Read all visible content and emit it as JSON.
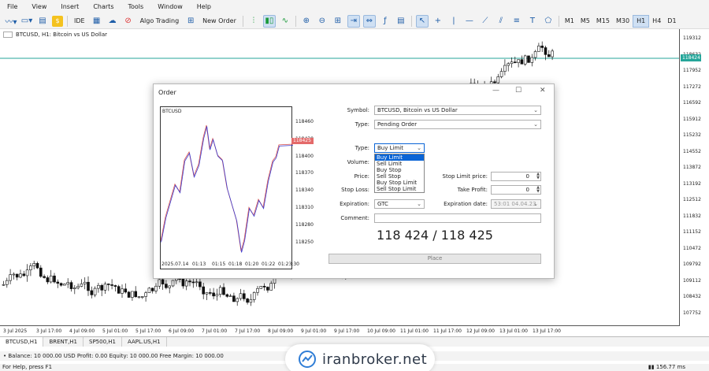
{
  "menu": [
    "File",
    "View",
    "Insert",
    "Charts",
    "Tools",
    "Window",
    "Help"
  ],
  "toolbar": {
    "ide_label": "IDE",
    "algo_label": "Algo Trading",
    "neworder_label": "New Order",
    "timeframes": [
      "M1",
      "M5",
      "M15",
      "M30",
      "H1",
      "H4",
      "D1"
    ],
    "active_timeframe": "H1"
  },
  "chart": {
    "title": "BTCUSD, H1: Bitcoin vs US Dollar",
    "current_price_tag": "118424",
    "price_labels": [
      "119312",
      "118632",
      "117952",
      "117272",
      "116592",
      "115912",
      "115232",
      "114552",
      "113872",
      "113192",
      "112512",
      "111832",
      "111152",
      "110472",
      "109792",
      "109112",
      "108432",
      "107752"
    ],
    "time_labels": [
      "3 Jul 2025",
      "3 Jul 17:00",
      "4 Jul 09:00",
      "5 Jul 01:00",
      "5 Jul 17:00",
      "6 Jul 09:00",
      "7 Jul 01:00",
      "7 Jul 17:00",
      "8 Jul 09:00",
      "9 Jul 01:00",
      "9 Jul 17:00",
      "10 Jul 09:00",
      "11 Jul 01:00",
      "11 Jul 17:00",
      "12 Jul 09:00",
      "13 Jul 01:00",
      "13 Jul 17:00"
    ]
  },
  "tabs": [
    "BTCUSD,H1",
    "BRENT,H1",
    "SP500,H1",
    "AAPL.US,H1"
  ],
  "active_tab": "BTCUSD,H1",
  "status": {
    "text": "Balance: 10 000.00 USD  Profit: 0.00  Equity: 10 000.00  Free Margin: 10 000.00",
    "help": "For Help, press F1",
    "net": "156.77 ms"
  },
  "watermark": "iranbroker.net",
  "dialog": {
    "title": "Order",
    "mini_chart": {
      "title": "BTCUSD",
      "price_labels": [
        "118460",
        "118430",
        "118400",
        "118370",
        "118340",
        "118310",
        "118280",
        "118250"
      ],
      "price_tag": "118425",
      "time_labels": [
        "2025.07.14",
        "01:13",
        "01:15",
        "01:18",
        "01:20",
        "01:22",
        "01:23:30"
      ]
    },
    "symbol_label": "Symbol:",
    "symbol_value": "BTCUSD, Bitcoin vs US Dollar",
    "type_label": "Type:",
    "type_value": "Pending Order",
    "order_type_label": "Type:",
    "order_type_value": "Buy Limit",
    "order_type_options": [
      "Buy Limit",
      "Sell Limit",
      "Buy Stop",
      "Sell Stop",
      "Buy Stop Limit",
      "Sell Stop Limit"
    ],
    "volume_label": "Volume:",
    "price_label": "Price:",
    "stoploss_label": "Stop Loss:",
    "stoplimit_label": "Stop Limit price:",
    "stoplimit_value": "0",
    "takeprofit_label": "Take Profit:",
    "takeprofit_value": "0",
    "expiration_label": "Expiration:",
    "expiration_value": "GTC",
    "expiration_date_label": "Expiration date:",
    "expiration_date_value": "53:01 04.04.23",
    "comment_label": "Comment:",
    "comment_value": "",
    "price_display": "118 424 / 118 425",
    "place_label": "Place"
  }
}
